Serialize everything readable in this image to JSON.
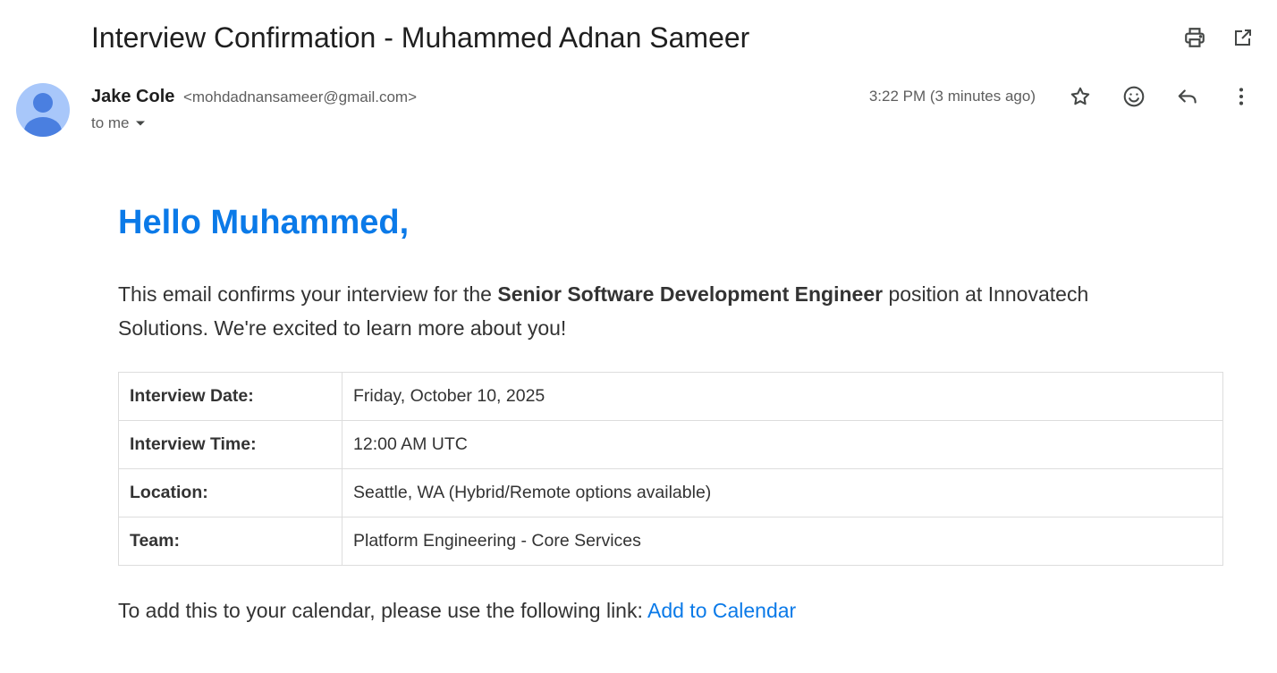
{
  "email": {
    "subject": "Interview Confirmation - Muhammed Adnan Sameer",
    "sender": {
      "name": "Jake Cole",
      "email": "<mohdadnansameer@gmail.com>",
      "to": "to me"
    },
    "timestamp": "3:22 PM (3 minutes ago)",
    "icons": {
      "print": "print-icon",
      "open_new_window": "open-in-new-window-icon",
      "star": "star-icon",
      "emoji": "emoji-reaction-icon",
      "reply": "reply-icon",
      "more": "more-vertical-icon",
      "dropdown": "caret-down-icon",
      "avatar": "default-avatar-icon"
    },
    "colors": {
      "accent": "#0b7ae8",
      "avatar_bg": "#a8c7fa",
      "avatar_fg": "#4a7fe0"
    }
  },
  "body": {
    "greeting": "Hello Muhammed,",
    "intro_before": "This email confirms your interview for the ",
    "intro_bold": "Senior Software Development Engineer",
    "intro_after": " position at Innovatech Solutions. We're excited to learn more about you!",
    "details": [
      {
        "label": "Interview Date:",
        "value": "Friday, October 10, 2025"
      },
      {
        "label": "Interview Time:",
        "value": "12:00 AM UTC"
      },
      {
        "label": "Location:",
        "value": "Seattle, WA (Hybrid/Remote options available)"
      },
      {
        "label": "Team:",
        "value": "Platform Engineering - Core Services"
      }
    ],
    "calendar_text": "To add this to your calendar, please use the following link: ",
    "calendar_link": "Add to Calendar"
  }
}
